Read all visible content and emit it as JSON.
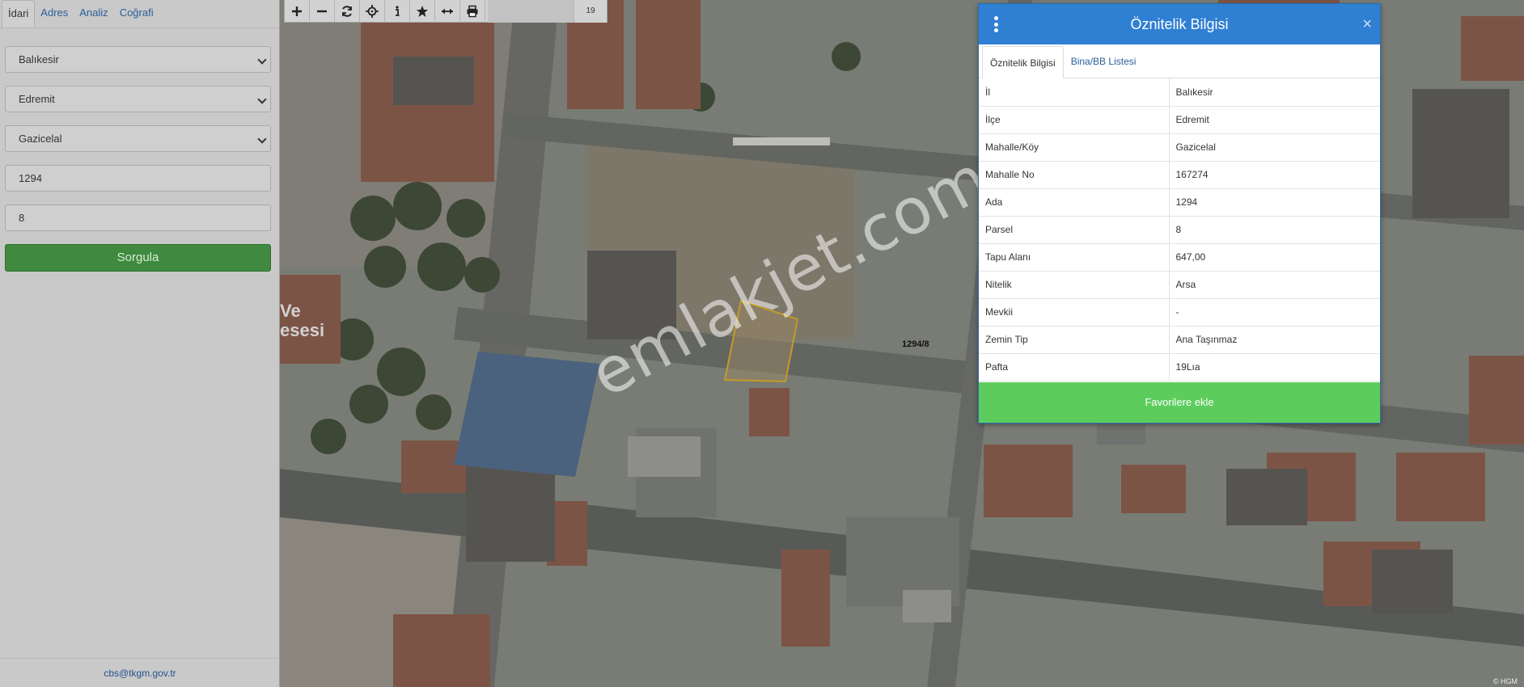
{
  "left_panel": {
    "tabs": [
      "İdari",
      "Adres",
      "Analiz",
      "Coğrafi"
    ],
    "province": "Balıkesir",
    "district": "Edremit",
    "neighborhood": "Gazicelal",
    "block_no": "1294",
    "parcel_no": "8",
    "query_button": "Sorgula",
    "footer_email": "cbs@tkgm.gov.tr"
  },
  "toolbar": {
    "buttons": [
      "zoom-in",
      "zoom-out",
      "refresh",
      "locate",
      "info",
      "favorite",
      "measure",
      "print"
    ],
    "zoom_level": "19"
  },
  "map": {
    "parcel_label": "1294/8",
    "watermark": "emlakjet.com",
    "building_label_1": "Ve",
    "building_label_2": "esesi",
    "attribution": "© HGM"
  },
  "attribute_panel": {
    "title": "Öznitelik Bilgisi",
    "close": "×",
    "tabs": [
      "Öznitelik Bilgisi",
      "Bina/BB Listesi"
    ],
    "rows": [
      {
        "key": "İl",
        "value": "Balıkesir"
      },
      {
        "key": "İlçe",
        "value": "Edremit"
      },
      {
        "key": "Mahalle/Köy",
        "value": "Gazicelal"
      },
      {
        "key": "Mahalle No",
        "value": "167274"
      },
      {
        "key": "Ada",
        "value": "1294"
      },
      {
        "key": "Parsel",
        "value": "8"
      },
      {
        "key": "Tapu Alanı",
        "value": "647,00"
      },
      {
        "key": "Nitelik",
        "value": "Arsa"
      },
      {
        "key": "Mevkii",
        "value": "-"
      },
      {
        "key": "Zemin Tip",
        "value": "Ana Taşınmaz"
      },
      {
        "key": "Pafta",
        "value": "19Lıa"
      }
    ],
    "favorite_button": "Favorilere ekle"
  },
  "colors": {
    "header_blue": "#2f7fd3",
    "favorite_green": "#5ccd5c",
    "query_green": "#3f8a3f",
    "parcel_outline": "#e2b020"
  }
}
